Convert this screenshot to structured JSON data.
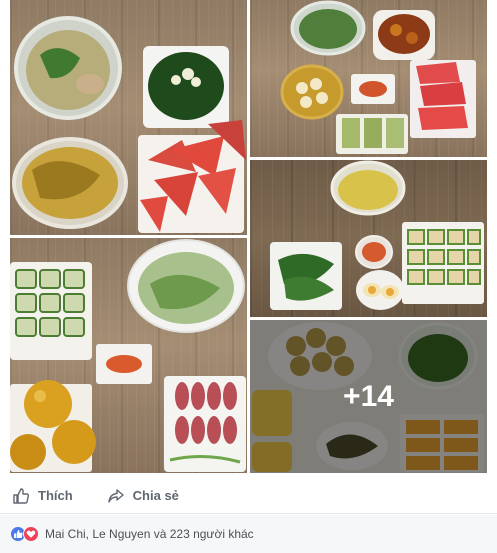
{
  "post": {
    "photo_grid": {
      "more_count_label": "+14"
    },
    "actions": {
      "like_label": "Thích",
      "share_label": "Chia sẻ"
    },
    "reactions": {
      "icons": [
        "like-icon",
        "love-icon"
      ],
      "summary": "Mai Chi, Le Nguyen và 223 người khác"
    }
  },
  "colors": {
    "action_text": "#606770",
    "reaction_like": "#4a79e8",
    "reaction_love": "#f0415b",
    "reactions_bar_bg": "#f6f7f9"
  }
}
